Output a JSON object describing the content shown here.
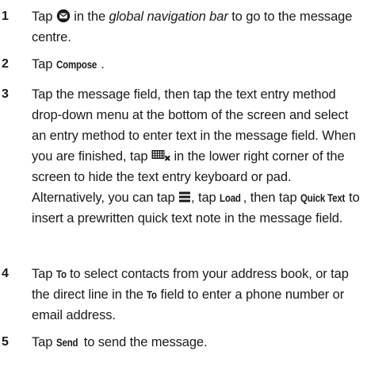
{
  "steps": [
    {
      "num": "1",
      "a": "Tap ",
      "icon": "message-icon",
      "b": " in the ",
      "b_italic": "global navigation bar",
      "c": " to go to the message centre."
    },
    {
      "num": "2",
      "a": "Tap ",
      "kw": "Compose",
      "b": "."
    },
    {
      "num": "3",
      "a": "Tap the message field, then tap the text entry method drop-down menu at the bottom of the screen and select an entry method to enter text in the message field. When you are finished, tap ",
      "icon": "hide-keyboard-icon",
      "b": " in the lower right corner of the screen to hide the text entry keyboard or pad. Alternatively, you can tap ",
      "icon2": "menu-icon",
      "c": ", tap ",
      "kw1": "Load",
      "d": ", then tap ",
      "kw2": "Quick Text",
      "e": " to insert a prewritten quick text note in the message field."
    },
    {
      "num": "4",
      "a": "Tap ",
      "kw1": "To",
      "b": " to select contacts from your address book, or tap the direct line in the ",
      "kw2": "To",
      "c": " field to enter a phone number or email address."
    },
    {
      "num": "5",
      "a": "Tap ",
      "kw": "Send",
      "b": " to send the message."
    }
  ]
}
